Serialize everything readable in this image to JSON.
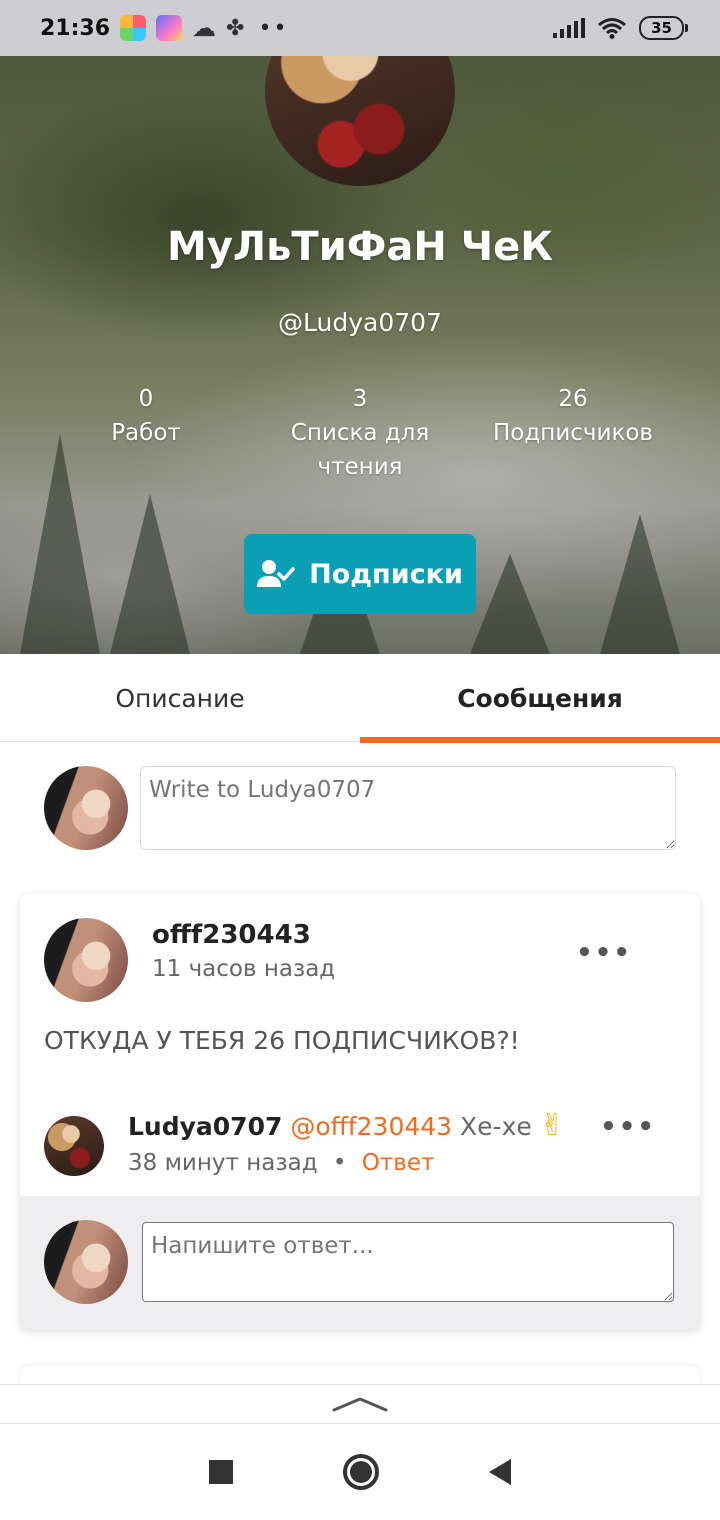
{
  "status_bar": {
    "time": "21:36",
    "battery": "35",
    "icons": [
      "app-icon-1",
      "app-icon-2",
      "cloud-icon",
      "pinwheel-icon",
      "more-dots-icon",
      "signal-icon",
      "wifi-icon",
      "battery-icon"
    ]
  },
  "profile": {
    "name": "МуЛьТиФаН ЧеК",
    "handle": "@Ludya0707",
    "stats": [
      {
        "value": "0",
        "label": "Работ"
      },
      {
        "value": "3",
        "label": "Списка для чтения"
      },
      {
        "value": "26",
        "label": "Подписчиков"
      }
    ],
    "follow_button": "Подписки",
    "follow_icon": "user-check-icon"
  },
  "tabs": [
    {
      "label": "Описание",
      "active": false
    },
    {
      "label": "Сообщения",
      "active": true
    }
  ],
  "compose": {
    "placeholder": "Write to Ludya0707"
  },
  "message": {
    "author": "offf230443",
    "time": "11 часов назад",
    "text": "ОТКУДА У ТЕБЯ 26 ПОДПИСЧИКОВ?!",
    "menu": "•••",
    "reply": {
      "author": "Ludya0707",
      "mention": "@offf230443",
      "text": "Хе-хе",
      "emoji": "✌",
      "time": "38 минут назад",
      "separator": "•",
      "reply_link": "Ответ",
      "menu": "•••"
    },
    "reply_placeholder": "Напишите ответ..."
  },
  "colors": {
    "accent": "#f26a1b",
    "button": "#0a9fb4"
  }
}
